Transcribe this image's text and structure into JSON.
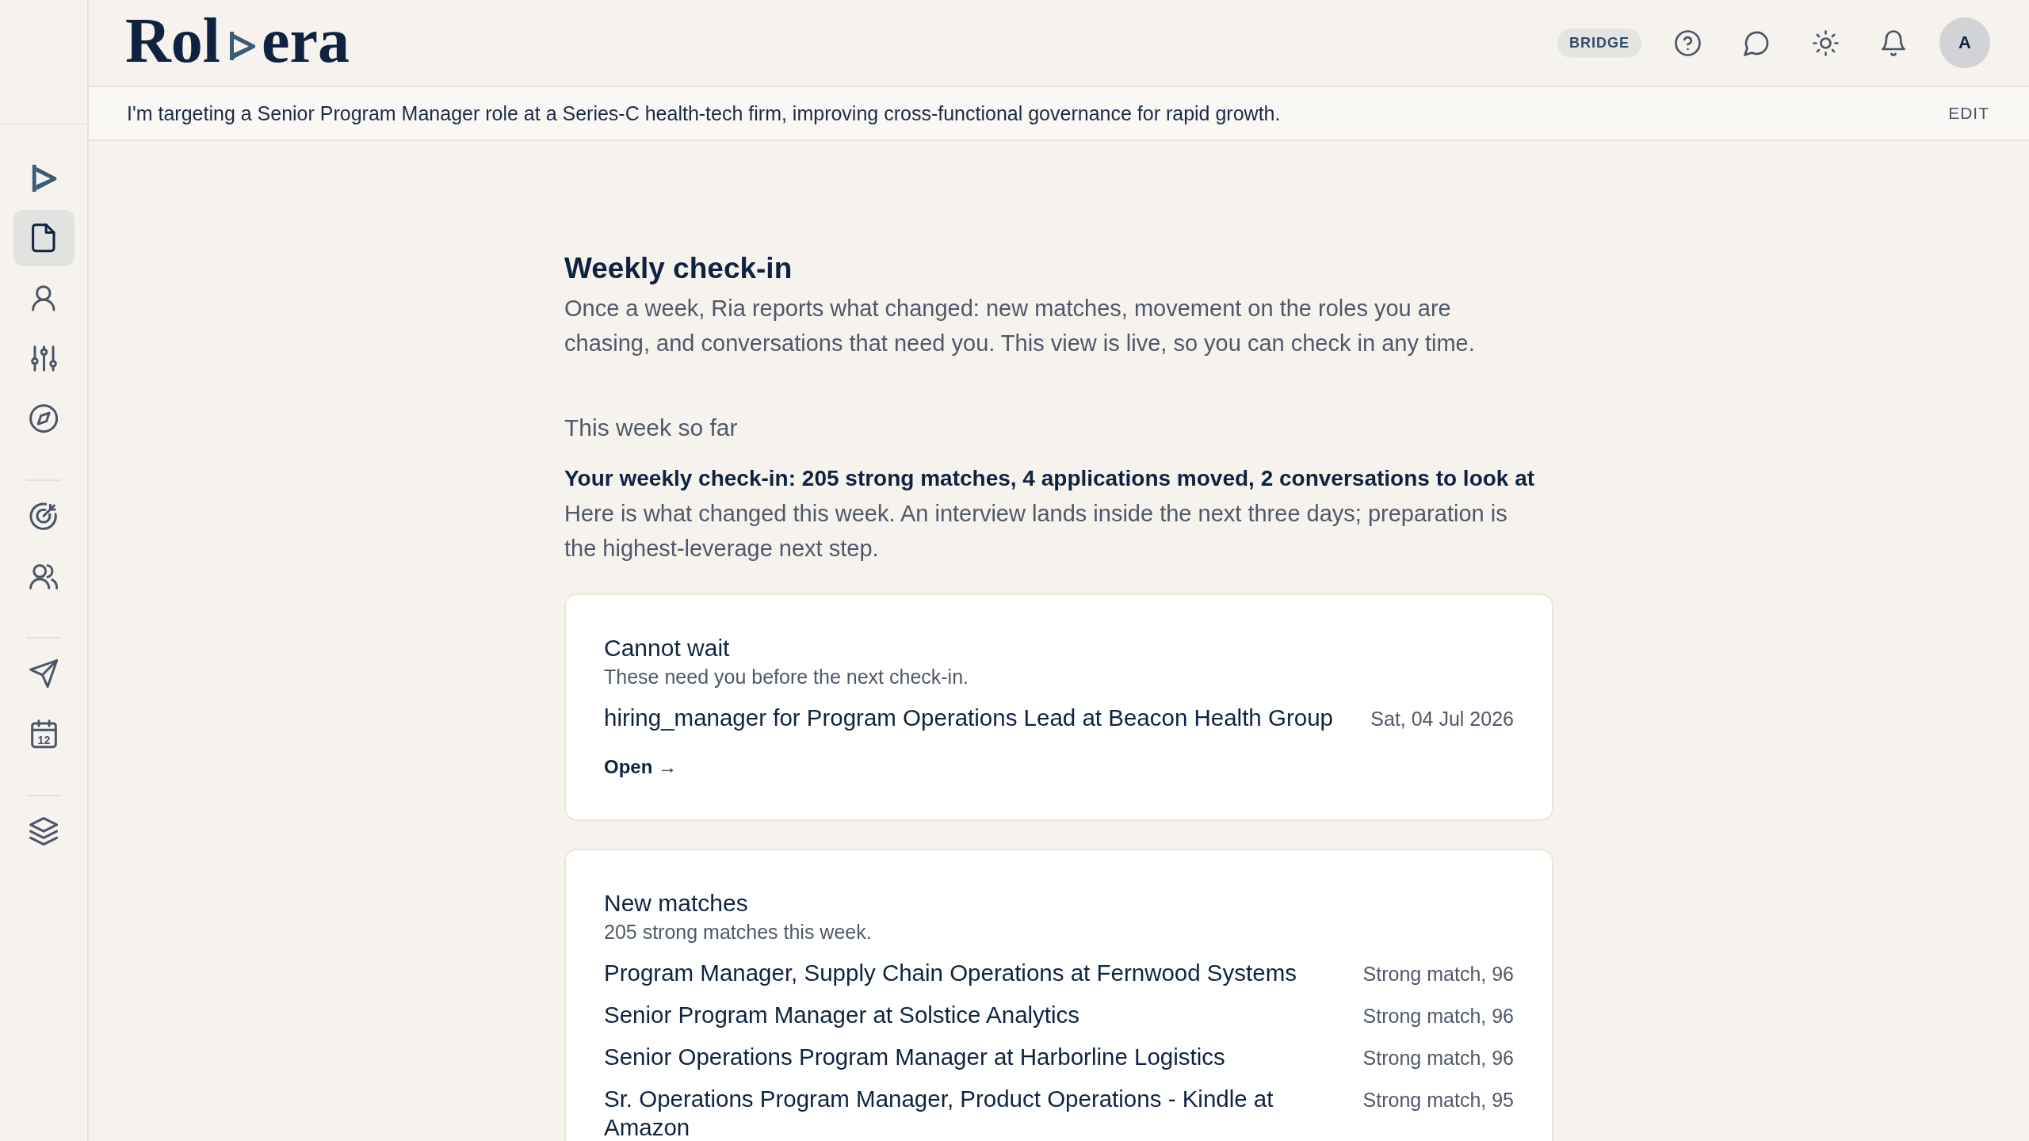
{
  "brand": {
    "name_start": "Rol",
    "name_end": "era"
  },
  "header": {
    "mode_tag": "BRIDGE",
    "avatar_initial": "A"
  },
  "sidebar": {
    "groups": [
      {
        "items": [
          {
            "selected": false
          },
          {
            "selected": true
          },
          {
            "selected": false
          },
          {
            "selected": false
          },
          {
            "selected": false
          }
        ]
      },
      {
        "items": [
          {
            "selected": false
          },
          {
            "selected": false
          }
        ]
      },
      {
        "items": [
          {
            "selected": false
          },
          {
            "selected": false,
            "icon_text": "12"
          }
        ]
      },
      {
        "items": [
          {
            "selected": false
          }
        ]
      }
    ]
  },
  "goal_bar": {
    "text": "I'm targeting a Senior Program Manager role at a Series-C health-tech firm, improving cross-functional governance for rapid growth.",
    "edit": "EDIT"
  },
  "page": {
    "title": "Weekly check-in",
    "intro": "Once a week, Ria reports what changed: new matches, movement on the roles you are chasing, and conversations that need you. This view is live, so you can check in any time.",
    "section_label": "This week so far",
    "headline": "Your weekly check-in: 205 strong matches, 4 applications moved, 2 conversations to look at",
    "summary": "Here is what changed this week. An interview lands inside the next three days; preparation is the highest-leverage next step."
  },
  "cards": [
    {
      "title": "Cannot wait",
      "subtitle": "These need you before the next check-in.",
      "items": [
        {
          "title": "hiring_manager for Program Operations Lead at Beacon Health Group",
          "detail": "Sat, 04 Jul 2026"
        }
      ],
      "link": "Open →"
    },
    {
      "title": "New matches",
      "subtitle": "205 strong matches this week.",
      "items": [
        {
          "title": "Program Manager, Supply Chain Operations at Fernwood Systems",
          "detail": "Strong match, 96"
        },
        {
          "title": "Senior Program Manager at Solstice Analytics",
          "detail": "Strong match, 96"
        },
        {
          "title": "Senior Operations Program Manager at Harborline Logistics",
          "detail": "Strong match, 96"
        },
        {
          "title": "Sr. Operations Program Manager, Product Operations - Kindle at Amazon",
          "detail": "Strong match, 95"
        }
      ]
    }
  ]
}
